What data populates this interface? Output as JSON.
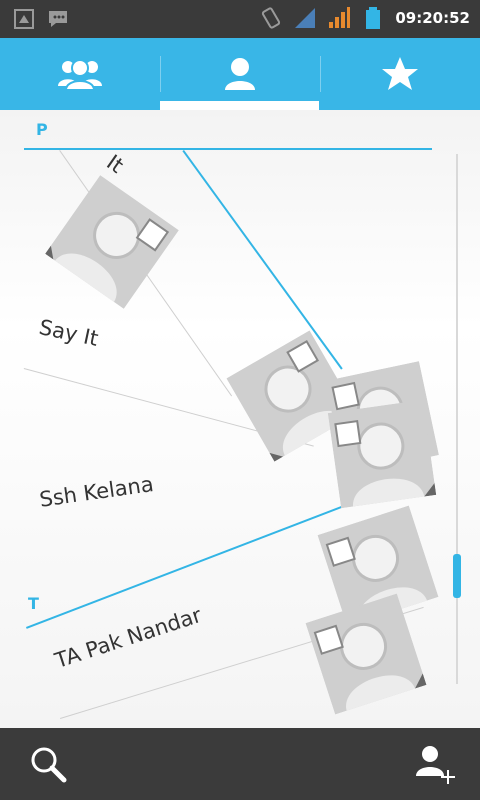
{
  "status_bar": {
    "time": "09:20:52",
    "icons": [
      "usb-icon",
      "messenger-icon",
      "vibrate-icon",
      "signal-1-icon",
      "signal-2-icon",
      "battery-icon"
    ]
  },
  "tabs": [
    {
      "name": "groups",
      "icon": "groups-icon",
      "selected": false
    },
    {
      "name": "contacts",
      "icon": "person-icon",
      "selected": true
    },
    {
      "name": "favorites",
      "icon": "star-icon",
      "selected": false
    }
  ],
  "sections": [
    {
      "letter": "P"
    },
    {
      "letter": "T"
    }
  ],
  "contacts": [
    {
      "name": "It"
    },
    {
      "name": "Say It"
    },
    {
      "name": "Ssh Kelana"
    },
    {
      "name": "TA Pak Nandar"
    }
  ],
  "bottom_bar": {
    "left_icon": "search-icon",
    "right_icon": "add-contact-icon"
  },
  "colors": {
    "accent": "#33b5e5",
    "tab_bar": "#39b6e7",
    "status_bar": "#3a3a3a",
    "bottom_bar": "#3b3b3b"
  }
}
